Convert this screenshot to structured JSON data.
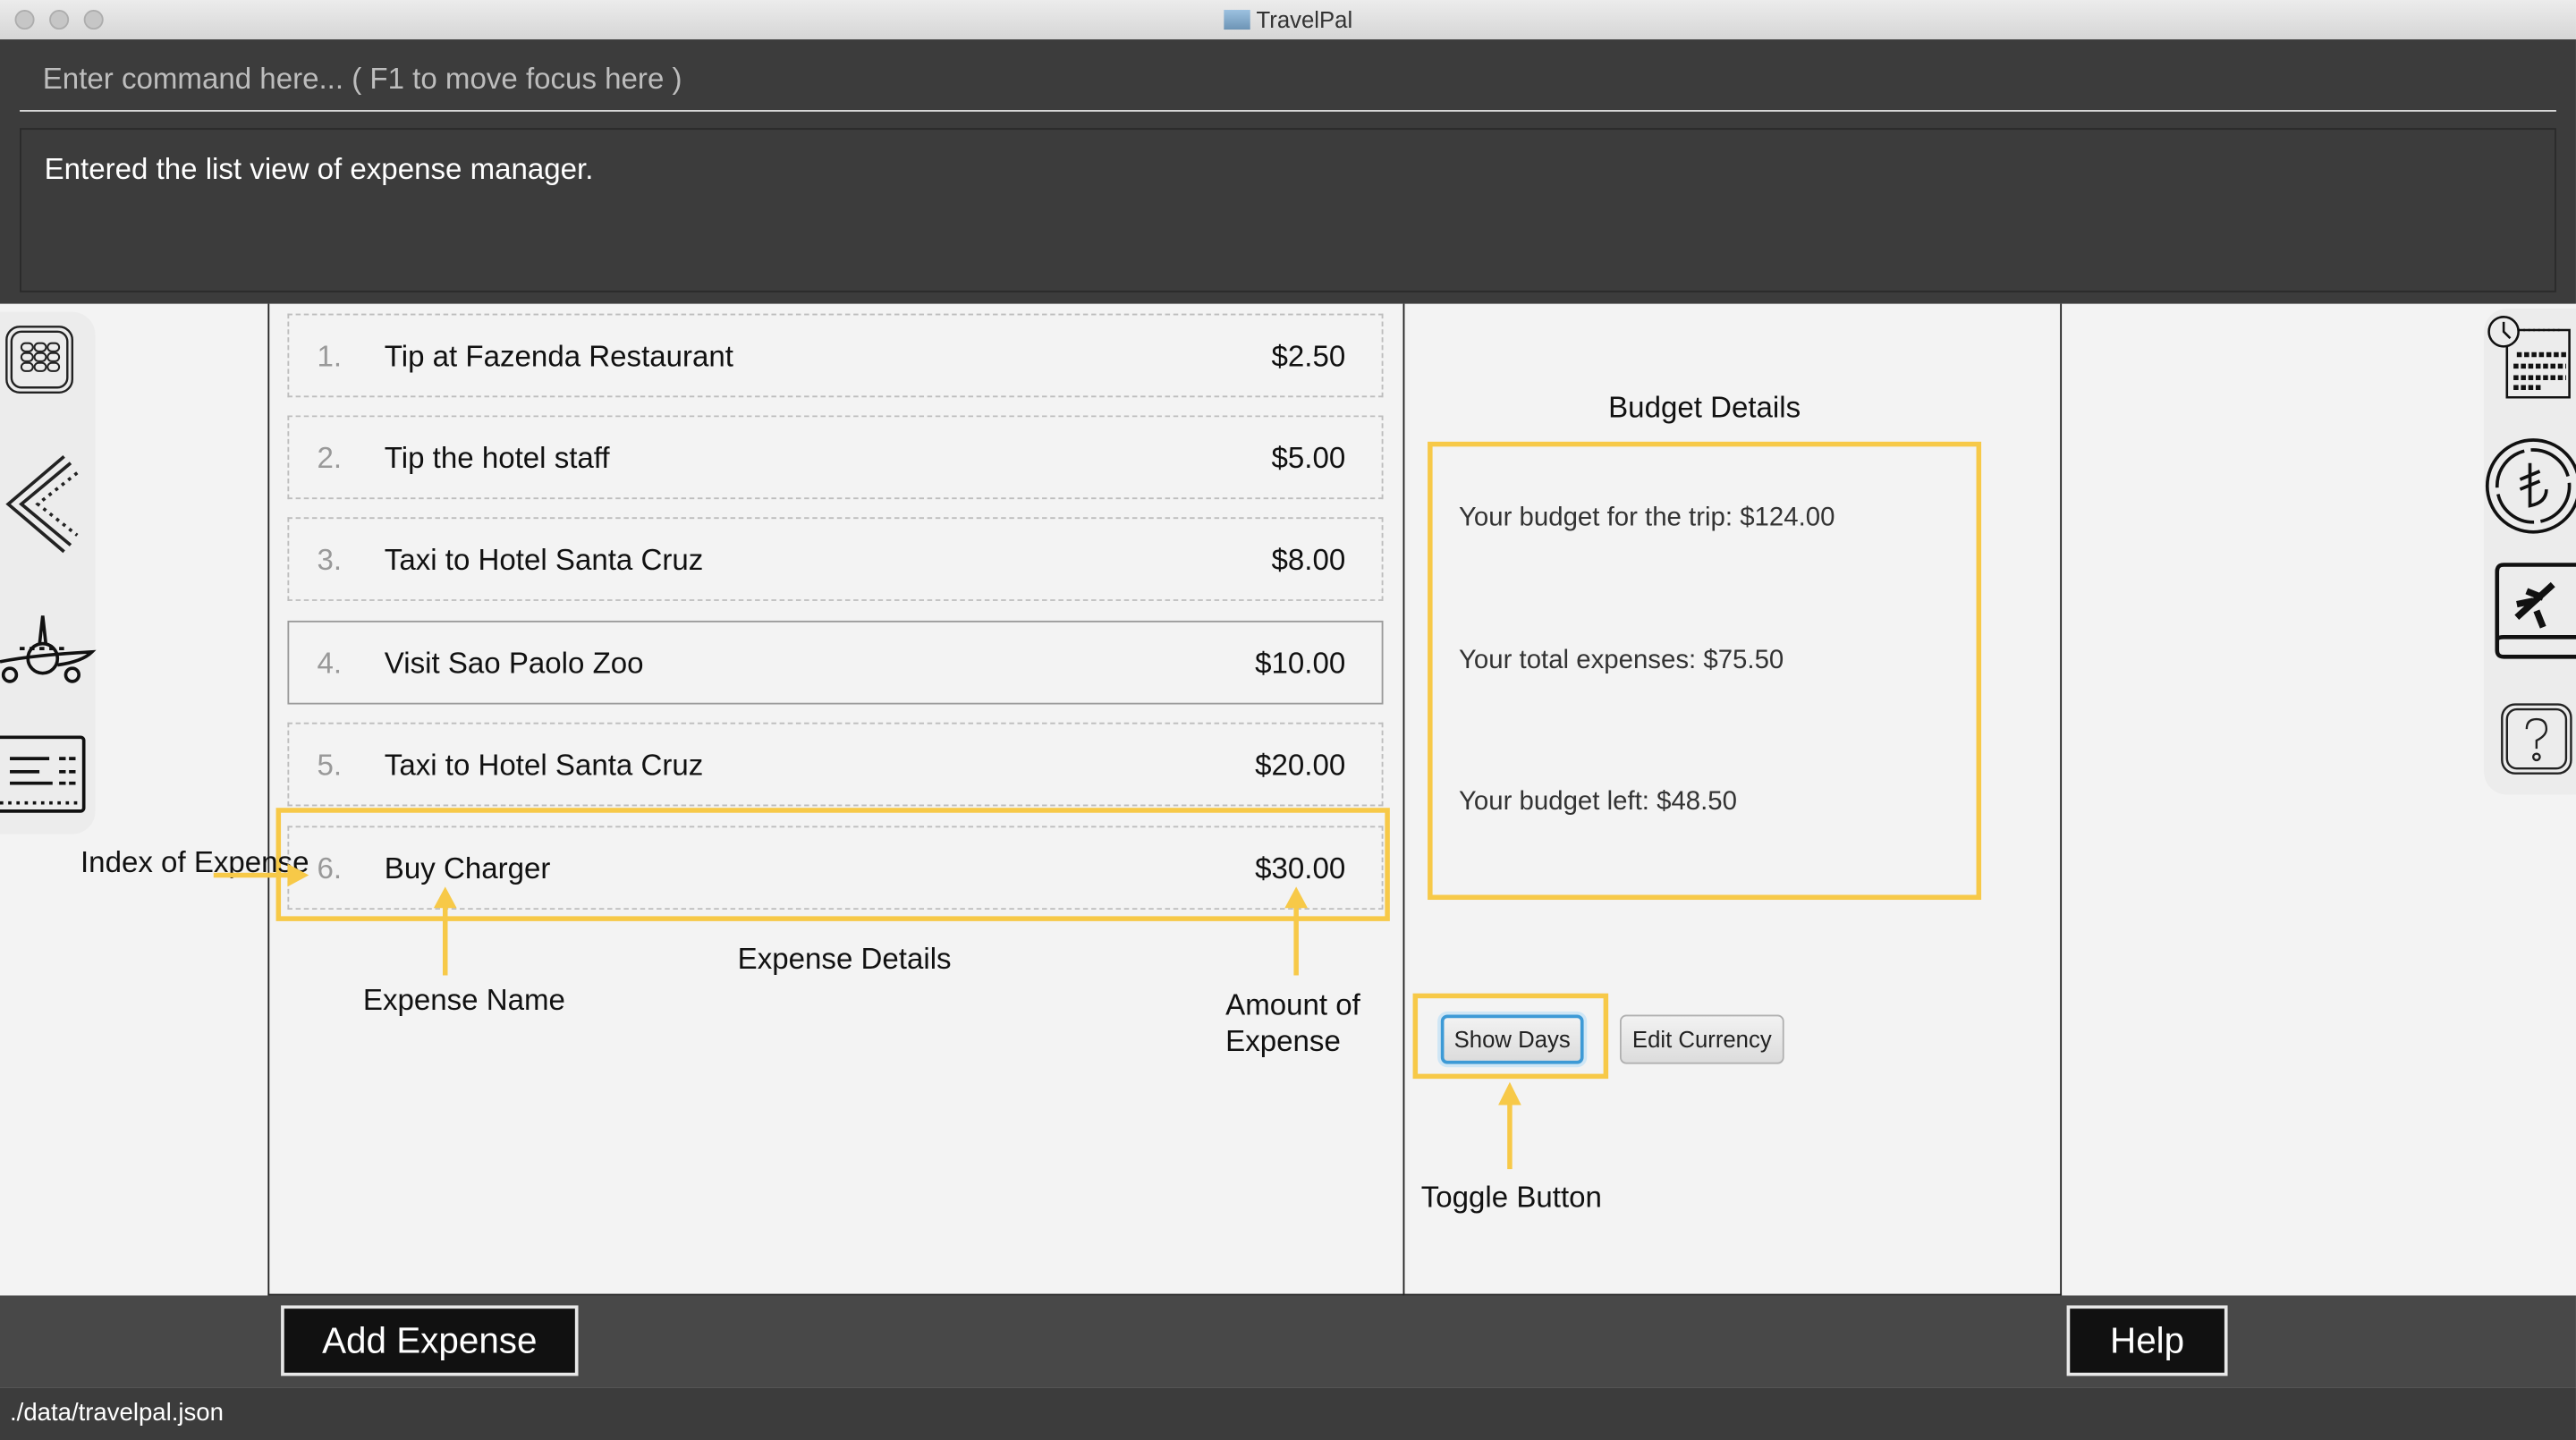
{
  "window": {
    "title": "TravelPal"
  },
  "command": {
    "placeholder": "Enter command here... ( F1 to move focus here )",
    "value": ""
  },
  "result_message": "Entered the list view of expense manager.",
  "left_nav": [
    "calendar-grid-icon",
    "ruler-back-icon",
    "airplane-icon",
    "ticket-icon"
  ],
  "right_nav": [
    "calendar-clock-icon",
    "currency-icon",
    "travel-book-icon",
    "help-icon"
  ],
  "expenses": [
    {
      "index": "1.",
      "name": "Tip at Fazenda Restaurant",
      "amount": "$2.50"
    },
    {
      "index": "2.",
      "name": "Tip the hotel staff",
      "amount": "$5.00"
    },
    {
      "index": "3.",
      "name": "Taxi to Hotel Santa Cruz",
      "amount": "$8.00"
    },
    {
      "index": "4.",
      "name": "Visit Sao Paolo Zoo",
      "amount": "$10.00"
    },
    {
      "index": "5.",
      "name": "Taxi to Hotel Santa Cruz",
      "amount": "$20.00"
    },
    {
      "index": "6.",
      "name": "Buy Charger",
      "amount": "$30.00"
    }
  ],
  "budget": {
    "title": "Budget Details",
    "budget_line": "Your budget for the trip: $124.00",
    "total_line": "Your total expenses: $75.50",
    "left_line": "Your budget left: $48.50"
  },
  "buttons": {
    "show_days": "Show Days",
    "edit_currency": "Edit Currency",
    "add_expense": "Add Expense",
    "help": "Help"
  },
  "annotations": {
    "index": "Index of Expense",
    "name": "Expense Name",
    "details": "Expense Details",
    "amount": "Amount of Expense",
    "toggle": "Toggle Button"
  },
  "status": {
    "path": "./data/travelpal.json"
  },
  "colors": {
    "annotation": "#f7c948",
    "dark": "#3c3c3c",
    "focus": "#3d9ad6"
  }
}
